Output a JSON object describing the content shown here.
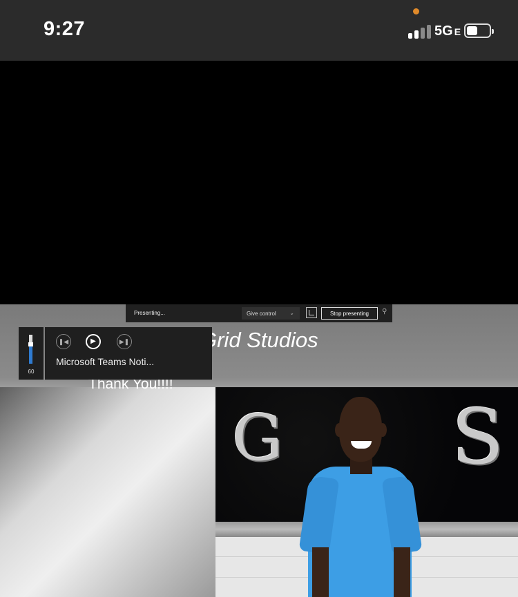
{
  "status_bar": {
    "time": "9:27",
    "network": "5G",
    "network_suffix": "E",
    "signal_bars_on": 2,
    "signal_bars_total": 4,
    "privacy_dot_color": "#e08a2a"
  },
  "share_toolbar": {
    "status": "Presenting...",
    "give_control": "Give control",
    "stop_presenting": "Stop presenting"
  },
  "volume_flyout": {
    "level": "60",
    "accent_color": "#2f7bd0"
  },
  "media_flyout": {
    "title": "Microsoft Teams Noti..."
  },
  "slide": {
    "title": "Grid Studios",
    "thank_you": "Thank You!!!!",
    "backdrop_letter_left": "G",
    "backdrop_letter_right": "S"
  },
  "icons": {
    "prev": "previous-track-icon",
    "play": "play-icon",
    "next": "next-track-icon",
    "share_window": "share-window-icon",
    "pin": "pin-icon",
    "chevron": "chevron-down-icon"
  }
}
